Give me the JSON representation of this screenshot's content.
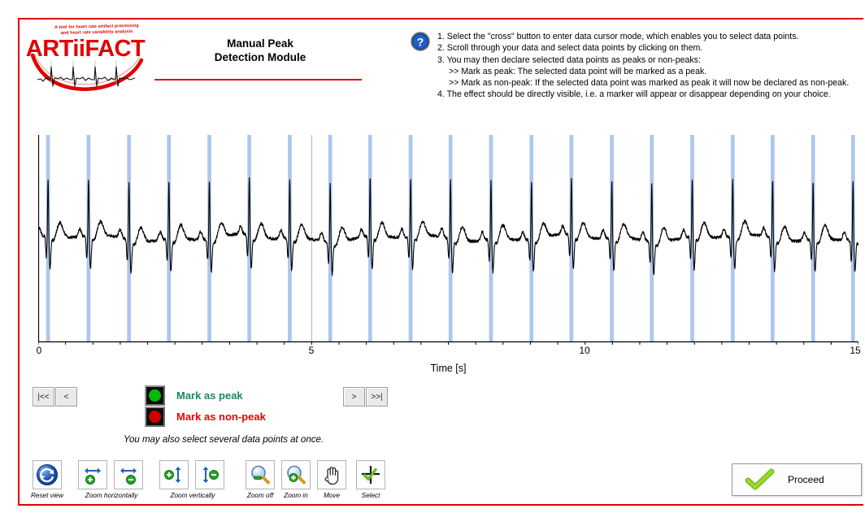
{
  "app": {
    "logo_text": "ARTiiFACT",
    "logo_tagline_line1": "A tool for heart rate artifact processing",
    "logo_tagline_line2": "and heart rate variability analysis",
    "title_line1": "Manual Peak",
    "title_line2": "Detection Module",
    "accent_color": "#e00000",
    "help_icon": "question-mark-circle-icon"
  },
  "instructions": [
    "1. Select the \"cross\" button to enter data cursor mode, which enables you to select data points.",
    "2. Scroll through your data and select data points by clicking on them.",
    "3. You may then declare selected data points as peaks or non-peaks:",
    ">> Mark as peak: The selected data point will be marked as a peak.",
    ">> Mark as non-peak: If the selected data point was marked as peak it will now be declared as non-peak.",
    "4. The effect should be directly visible, i.e. a marker will appear or disappear depending on your choice."
  ],
  "chart_data": {
    "type": "line",
    "title": "",
    "xlabel": "Time [s]",
    "ylabel": "",
    "xlim": [
      0,
      15
    ],
    "ylim": [
      -1,
      1
    ],
    "xticks": [
      0,
      5,
      10,
      15
    ],
    "xticklabels": [
      "0",
      "5",
      "10",
      "15"
    ],
    "minor_tick_step": 0.5,
    "grid": false,
    "signal_name": "ECG",
    "signal_color": "#000000",
    "peak_marker_color": "#aec6ee",
    "peak_marker_width_s": 0.07,
    "cursor_line_x": 5.0,
    "peaks_s": [
      0.18,
      0.92,
      1.66,
      2.39,
      3.13,
      3.86,
      4.6,
      5.34,
      6.07,
      6.81,
      7.54,
      8.28,
      9.02,
      9.75,
      10.49,
      11.22,
      11.96,
      12.7,
      13.43,
      14.17,
      14.9
    ],
    "sampling_note": "ECG waveform with 21 detected R-peaks over 15 s"
  },
  "navigation": {
    "first_label": "|<<",
    "prev_label": "<",
    "next_label": ">",
    "last_label": ">>|"
  },
  "legend": {
    "peak": {
      "label": "Mark as peak",
      "color": "#00bb00",
      "text_color": "#1a8a5a"
    },
    "non_peak": {
      "label": "Mark as non-peak",
      "color": "#cc0000",
      "text_color": "#ee0000"
    },
    "hint": "You may also select several data points at once."
  },
  "toolbar": [
    {
      "name": "reset-view",
      "caption": "Reset view",
      "icon": "refresh-circle-icon"
    },
    {
      "name": "zoom-horizontally-in",
      "caption": "Zoom horizontally",
      "icon": "arrows-horizontal-plus-icon"
    },
    {
      "name": "zoom-horizontally-out",
      "caption": "",
      "icon": "arrows-horizontal-minus-icon"
    },
    {
      "name": "zoom-vertically-in",
      "caption": "Zoom vertically",
      "icon": "arrows-vertical-plus-icon"
    },
    {
      "name": "zoom-vertically-out",
      "caption": "",
      "icon": "arrows-vertical-minus-icon"
    },
    {
      "name": "zoom-off",
      "caption": "Zoom off",
      "icon": "magnifier-minus-icon"
    },
    {
      "name": "zoom-in",
      "caption": "Zoom in",
      "icon": "magnifier-plus-icon"
    },
    {
      "name": "move",
      "caption": "Move",
      "icon": "hand-icon"
    },
    {
      "name": "select",
      "caption": "Select",
      "icon": "cross-check-icon"
    }
  ],
  "proceed": {
    "label": "Proceed",
    "icon": "green-check-icon"
  }
}
